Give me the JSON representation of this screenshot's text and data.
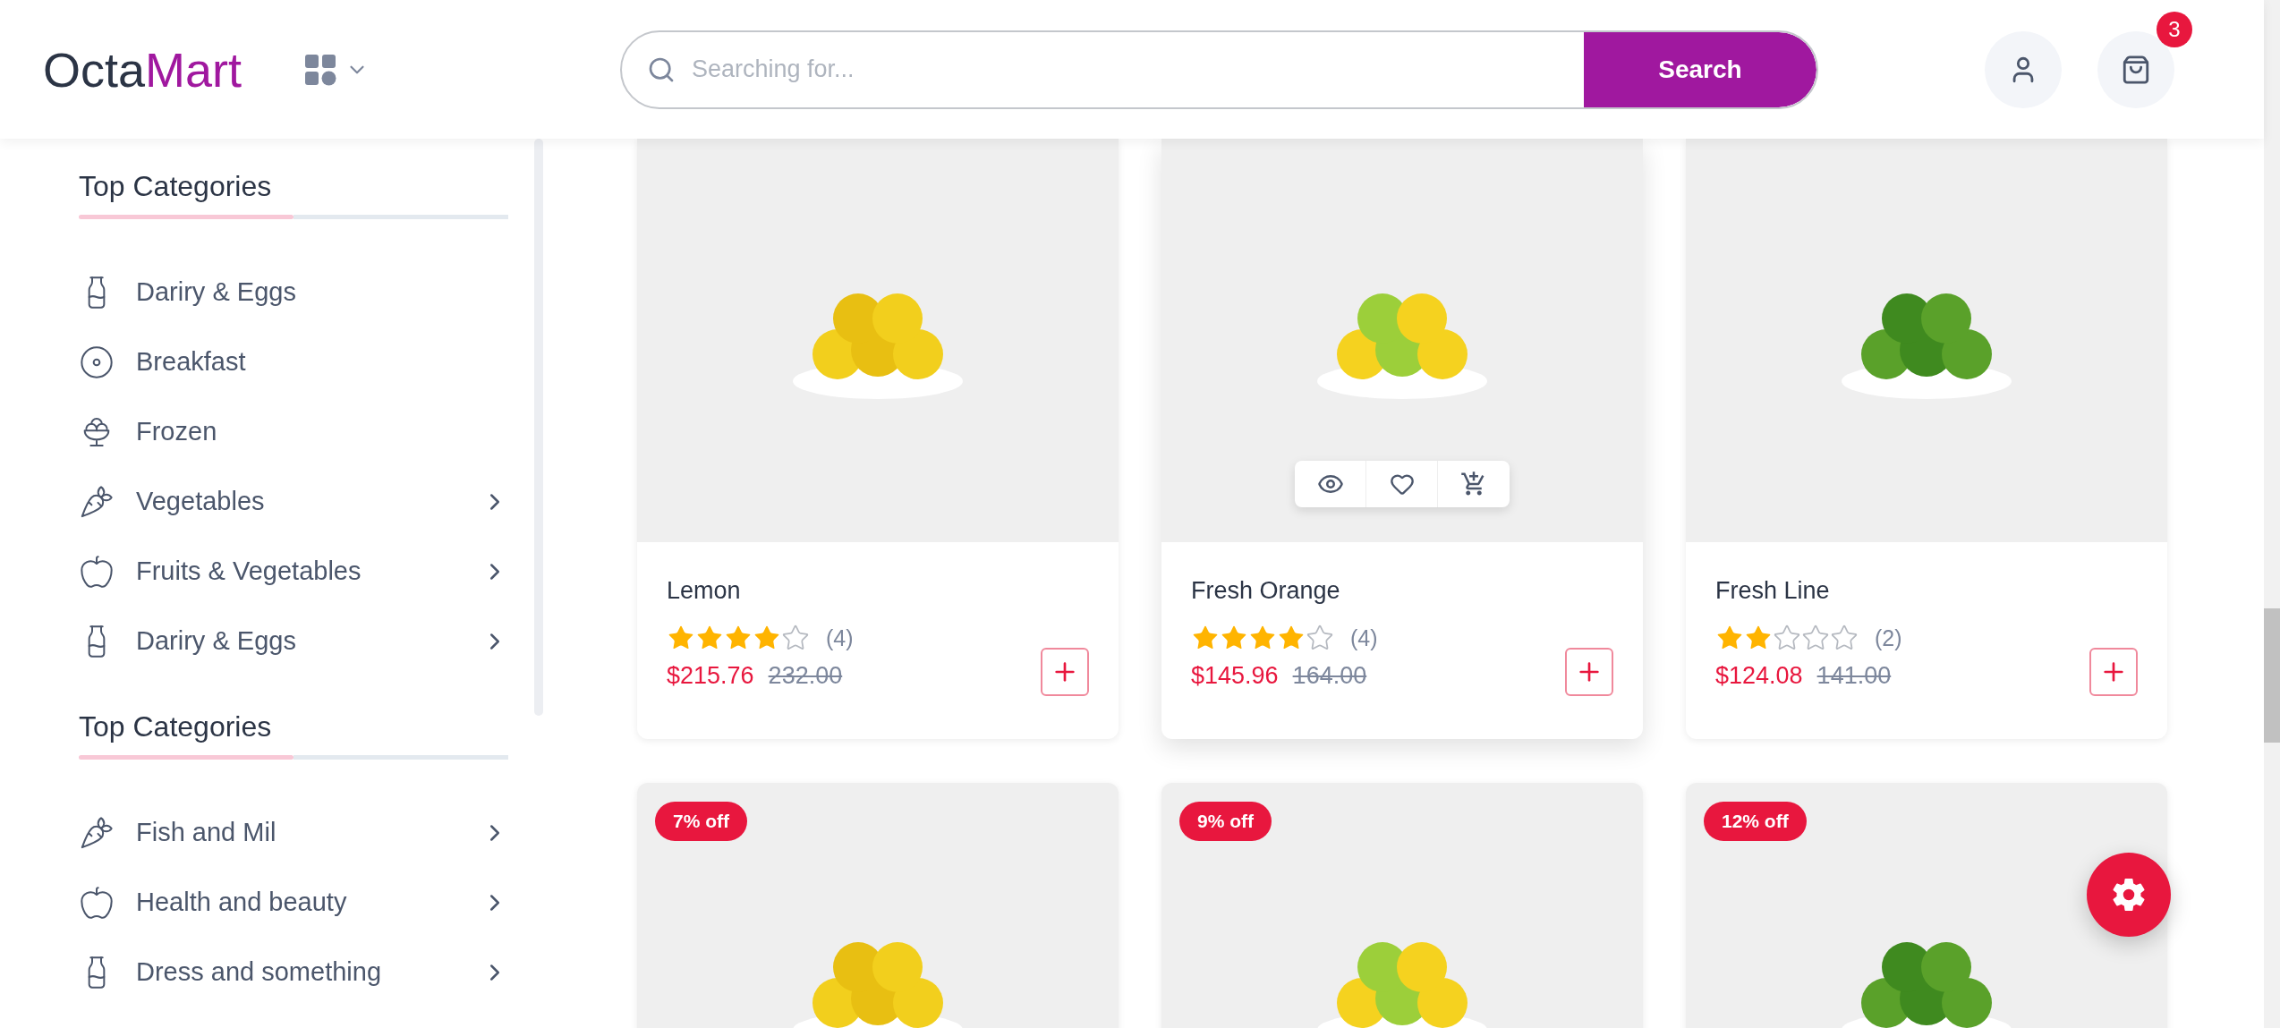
{
  "header": {
    "logo": {
      "part_1": "Octa",
      "part_2": "Mart"
    },
    "search": {
      "placeholder": "Searching for...",
      "button": "Search"
    },
    "cart_count": "3"
  },
  "sidebar": {
    "sections": [
      {
        "title": "Top Categories",
        "items": [
          {
            "label": "Dariry & Eggs",
            "has_submenu": false
          },
          {
            "label": "Breakfast",
            "has_submenu": false
          },
          {
            "label": "Frozen",
            "has_submenu": false
          },
          {
            "label": "Vegetables",
            "has_submenu": true
          },
          {
            "label": "Fruits & Vegetables",
            "has_submenu": true
          },
          {
            "label": "Dariry & Eggs",
            "has_submenu": true
          }
        ]
      },
      {
        "title": "Top Categories",
        "items": [
          {
            "label": "Fish and Mil",
            "has_submenu": true
          },
          {
            "label": "Health and beauty",
            "has_submenu": true
          },
          {
            "label": "Dress and something",
            "has_submenu": true
          }
        ]
      }
    ]
  },
  "products": [
    {
      "name": "Lemon",
      "stars": 4,
      "rating_count": "(4)",
      "price": "$215.76",
      "old_price": "232.00",
      "hovered": false
    },
    {
      "name": "Fresh Orange",
      "stars": 4,
      "rating_count": "(4)",
      "price": "$145.96",
      "old_price": "164.00",
      "hovered": true
    },
    {
      "name": "Fresh Line",
      "stars": 2,
      "rating_count": "(2)",
      "price": "$124.08",
      "old_price": "141.00",
      "hovered": false
    }
  ],
  "more_products": [
    {
      "discount": "7% off"
    },
    {
      "discount": "9% off"
    },
    {
      "discount": "12% off"
    }
  ]
}
